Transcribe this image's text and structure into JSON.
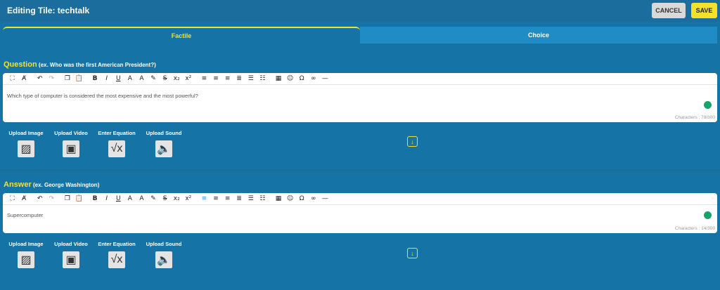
{
  "header": {
    "title": "Editing Tile: techtalk",
    "cancel_label": "CANCEL",
    "save_label": "SAVE"
  },
  "tabs": [
    {
      "label": "Factile",
      "active": true
    },
    {
      "label": "Choice",
      "active": false
    }
  ],
  "question": {
    "label": "Question",
    "hint": "(ex. Who was the first American President?)",
    "text": "Which type of computer is considered the most expensive and the most powerful?",
    "char_count": "Characters : 78/300"
  },
  "answer": {
    "label": "Answer",
    "hint": "(ex. George Washington)",
    "text": "Supercomputer",
    "char_count": "Characters : 14/300"
  },
  "uploads": [
    {
      "label": "Upload Image",
      "icon": "image-icon"
    },
    {
      "label": "Upload Video",
      "icon": "video-icon"
    },
    {
      "label": "Enter Equation",
      "icon": "sqrt-icon"
    },
    {
      "label": "Upload Sound",
      "icon": "speaker-icon"
    }
  ],
  "colors": {
    "background": "#1673a6",
    "accent": "#f3e228",
    "inactive_tab": "#1f8cc6"
  }
}
